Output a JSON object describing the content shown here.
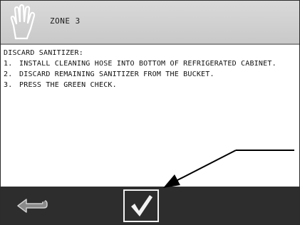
{
  "header": {
    "icon": "hand-icon",
    "zone_title": "ZONE 3"
  },
  "instructions": {
    "heading": "DISCARD SANITIZER:",
    "steps": [
      {
        "num": "1.",
        "text": "INSTALL CLEANING HOSE INTO BOTTOM OF REFRIGERATED CABINET."
      },
      {
        "num": "2.",
        "text": "DISCARD REMAINING SANITIZER FROM THE BUCKET."
      },
      {
        "num": "3.",
        "text": "PRESS THE GREEN CHECK."
      }
    ]
  },
  "footer": {
    "back_icon": "back-arrow-icon",
    "confirm_icon": "checkmark-icon"
  },
  "colors": {
    "header_bg": "#cfcfcf",
    "footer_bg": "#2d2d2d",
    "icon_light": "#f2f2f2"
  }
}
